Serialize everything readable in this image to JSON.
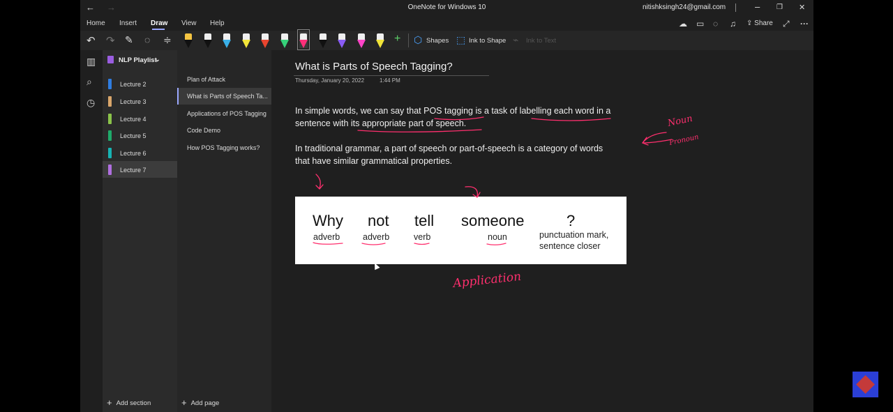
{
  "window": {
    "title": "OneNote for Windows 10",
    "account": "nitishksingh24@gmail.com",
    "back_glyph": "←",
    "forward_glyph": "→",
    "minimize_glyph": "–",
    "restore_glyph": "❐",
    "close_glyph": "✕"
  },
  "ribbon": {
    "tabs": [
      "Home",
      "Insert",
      "Draw",
      "View",
      "Help"
    ],
    "active_tab": "Draw",
    "share_label": "Share",
    "more_glyph": "···"
  },
  "toolbar": {
    "undo_glyph": "↶",
    "redo_glyph": "↷",
    "pens": [
      {
        "name": "pen-black-yellow",
        "color": "#111111",
        "cap": "#f5c542"
      },
      {
        "name": "pen-black",
        "color": "#111111",
        "cap": "#f0f0f0"
      },
      {
        "name": "pen-blue",
        "color": "#3ab0e8",
        "cap": "#f0f0f0"
      },
      {
        "name": "pen-yellow",
        "color": "#f2e53a",
        "cap": "#f0f0f0"
      },
      {
        "name": "pen-red",
        "color": "#e8452f",
        "cap": "#f0f0f0"
      },
      {
        "name": "pen-green",
        "color": "#36d17a",
        "cap": "#f0f0f0"
      },
      {
        "name": "pen-pink-selected",
        "color": "#ff2f7a",
        "cap": "#f0f0f0"
      },
      {
        "name": "pen-black-2",
        "color": "#111111",
        "cap": "#f0f0f0"
      },
      {
        "name": "pen-purple",
        "color": "#8a5cf5",
        "cap": "#f0f0f0"
      },
      {
        "name": "pen-magenta",
        "color": "#ff45c8",
        "cap": "#f0f0f0"
      },
      {
        "name": "pen-yellow-2",
        "color": "#f2e53a",
        "cap": "#f0f0f0"
      }
    ],
    "add_pen_glyph": "+",
    "shapes_label": "Shapes",
    "ink_to_shape_label": "Ink to Shape",
    "ink_to_text_label": "Ink to Text"
  },
  "notebook": {
    "name": "NLP Playlist",
    "sections": [
      {
        "label": "Lecture 2",
        "color": "#2f7de1"
      },
      {
        "label": "Lecture 3",
        "color": "#d9a66b"
      },
      {
        "label": "Lecture 4",
        "color": "#8bc34a"
      },
      {
        "label": "Lecture 5",
        "color": "#1faa6a"
      },
      {
        "label": "Lecture 6",
        "color": "#17b3b3"
      },
      {
        "label": "Lecture 7",
        "color": "#b06fe0"
      }
    ],
    "selected_section": "Lecture 7",
    "add_section_label": "Add section"
  },
  "pages": {
    "items": [
      "Plan of Attack",
      "What is Parts of Speech Ta...",
      "Applications of POS Tagging",
      "Code Demo",
      "How POS Tagging works?"
    ],
    "selected_page": "What is Parts of Speech Ta...",
    "add_page_label": "Add page"
  },
  "note": {
    "title": "What is Parts of Speech Tagging?",
    "date": "Thursday, January 20, 2022",
    "time": "1:44 PM",
    "paragraph1_line1": " In simple words, we can say that POS tagging is a task of labelling each word in a",
    "paragraph1_line2": "sentence with its appropriate part of speech.",
    "paragraph2_line1": "In traditional grammar, a part of speech or part-of-speech is a category of words",
    "paragraph2_line2": "that have similar grammatical properties.",
    "image": {
      "words": [
        "Why",
        "not",
        "tell",
        "someone",
        "?"
      ],
      "tags": [
        "adverb",
        "adverb",
        "verb",
        "noun",
        "punctuation mark,",
        "sentence closer"
      ]
    },
    "ink_annotations": [
      "Noun",
      "Pronoun",
      "Application"
    ]
  }
}
